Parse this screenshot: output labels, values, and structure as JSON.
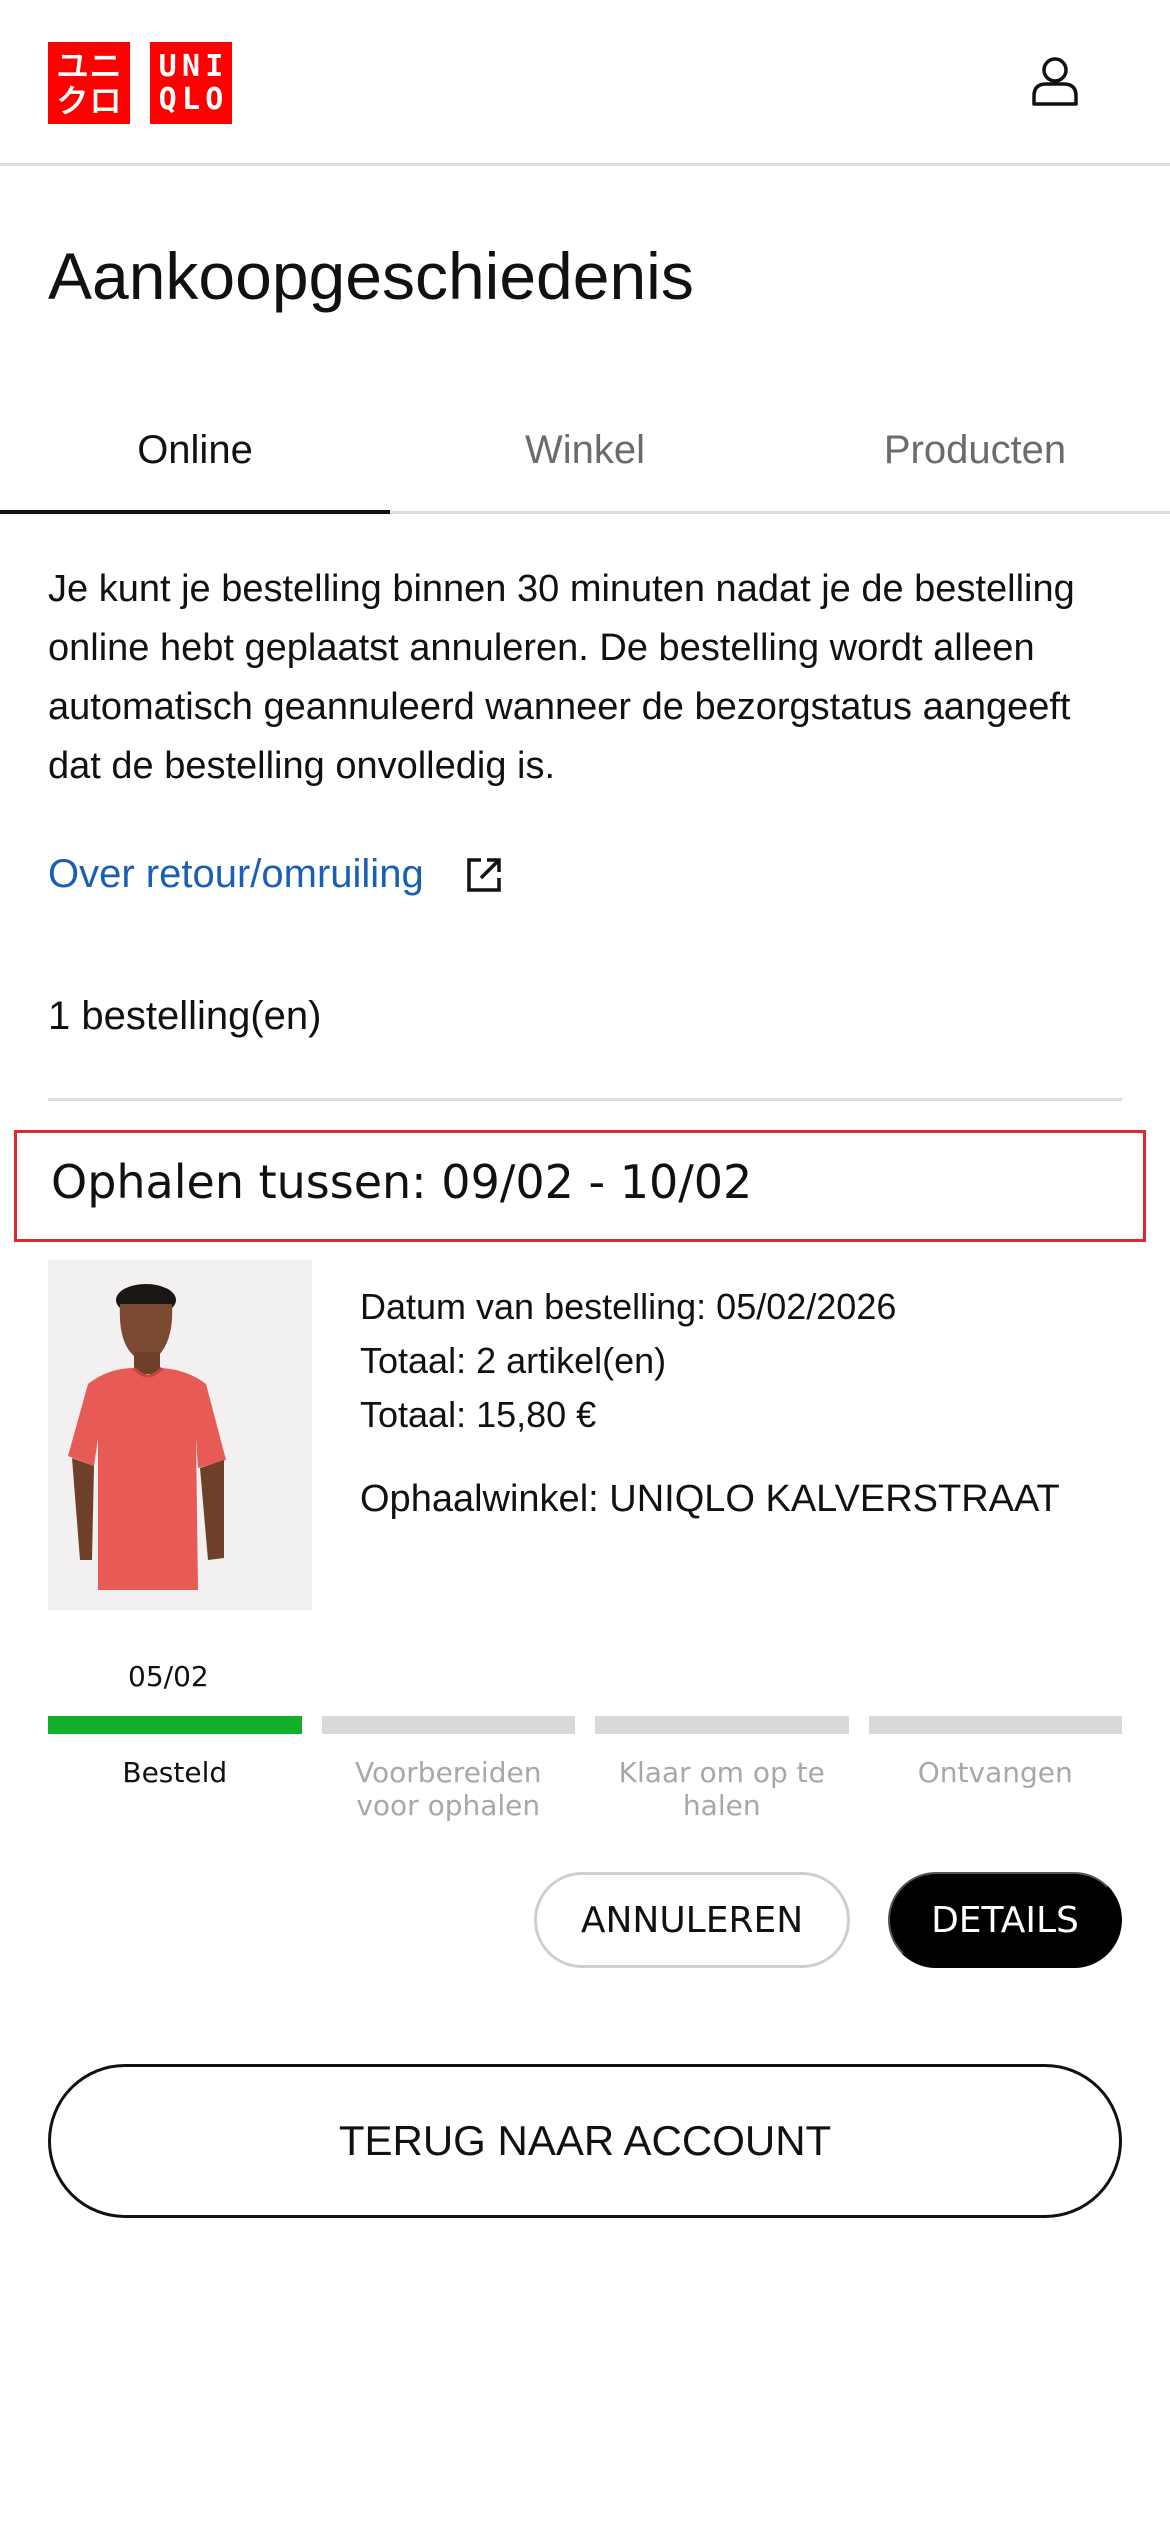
{
  "header": {
    "logo_left": [
      "ユ",
      "ニ",
      "ク",
      "ロ"
    ],
    "logo_right": [
      "U",
      "N",
      "I",
      "",
      "Q",
      "L",
      "O",
      ""
    ],
    "brand_color": "#ff0000",
    "account_icon": "user-icon"
  },
  "page": {
    "title": "Aankoopgeschiedenis"
  },
  "tabs": [
    {
      "label": "Online",
      "active": true
    },
    {
      "label": "Winkel",
      "active": false
    },
    {
      "label": "Producten",
      "active": false
    }
  ],
  "info": {
    "text": "Je kunt je bestelling binnen 30 minuten nadat je de bestelling online hebt geplaatst annuleren. De bestelling wordt alleen automatisch geannuleerd wanneer de bezorgstatus aangeeft dat de bestelling onvolledig is.",
    "link_label": "Over retour/omruiling",
    "link_color": "#1a5fb4"
  },
  "orders_count": "1 bestelling(en)",
  "order": {
    "pickup": "Ophalen tussen: 09/02 - 10/02",
    "date": "Datum van bestelling: 05/02/2026",
    "items": "Totaal: 2 artikel(en)",
    "total": "Totaal: 15,80 €",
    "store": "Ophaalwinkel: UNIQLO KALVERSTRAAT",
    "progress_date": "05/02",
    "steps": [
      {
        "label": "Besteld",
        "done": true
      },
      {
        "label": "Voorbereiden voor ophalen",
        "done": false
      },
      {
        "label": "Klaar om op te halen",
        "done": false
      },
      {
        "label": "Ontvangen",
        "done": false
      }
    ],
    "progress_color": "#11b02a",
    "cancel_label": "ANNULEREN",
    "details_label": "DETAILS"
  },
  "back_label": "TERUG NAAR ACCOUNT"
}
